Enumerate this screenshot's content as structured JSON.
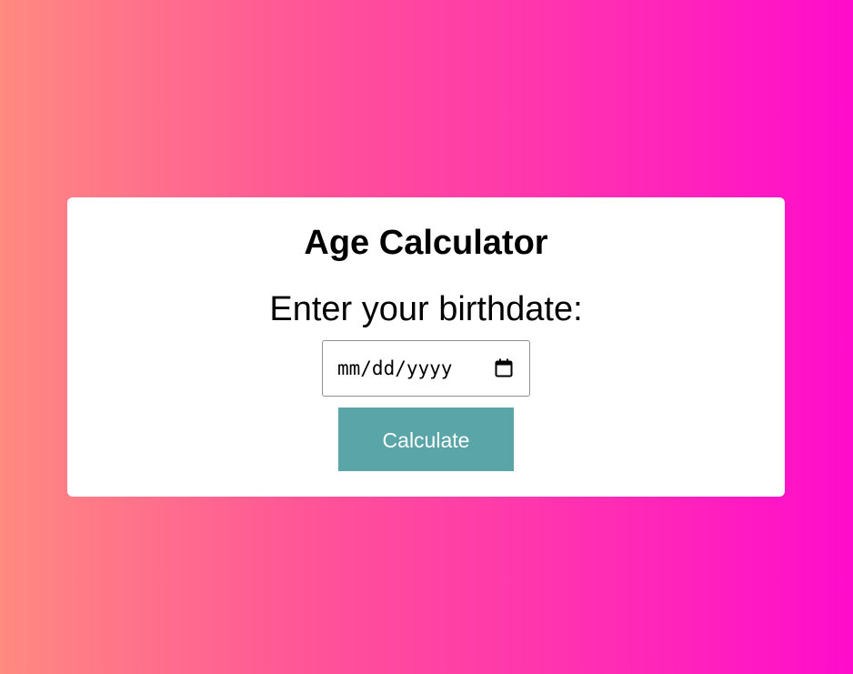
{
  "card": {
    "title": "Age Calculator",
    "prompt": "Enter your birthdate:",
    "date_input": {
      "placeholder": "mm/dd/yyyy",
      "icon": "calendar-icon"
    },
    "calculate_label": "Calculate"
  },
  "colors": {
    "background_gradient_start": "#ff8a80",
    "background_gradient_end": "#ff0ccc",
    "button": "#5aa5a8",
    "card": "#ffffff"
  }
}
